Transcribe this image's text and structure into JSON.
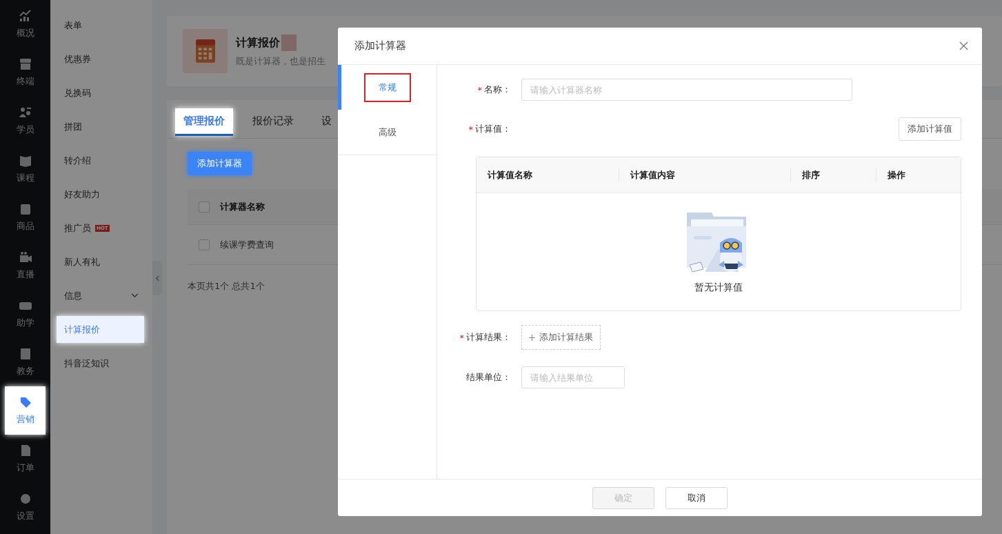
{
  "nav": [
    {
      "label": "概况",
      "selected": false
    },
    {
      "label": "终端",
      "selected": false
    },
    {
      "label": "学员",
      "selected": false
    },
    {
      "label": "课程",
      "selected": false
    },
    {
      "label": "商品",
      "selected": false
    },
    {
      "label": "直播",
      "selected": false
    },
    {
      "label": "助学",
      "selected": false
    },
    {
      "label": "教务",
      "selected": false
    },
    {
      "label": "营销",
      "selected": true
    },
    {
      "label": "订单",
      "selected": false
    },
    {
      "label": "设置",
      "selected": false
    }
  ],
  "submenu": [
    {
      "label": "表单",
      "selected": false
    },
    {
      "label": "优惠券",
      "selected": false
    },
    {
      "label": "兑换码",
      "selected": false
    },
    {
      "label": "拼团",
      "selected": false
    },
    {
      "label": "转介绍",
      "selected": false
    },
    {
      "label": "好友助力",
      "selected": false
    },
    {
      "label": "推广员",
      "selected": false,
      "badge": "HOT"
    },
    {
      "label": "新人有礼",
      "selected": false
    },
    {
      "label": "信息",
      "selected": false,
      "expandable": true
    },
    {
      "label": "计算报价",
      "selected": true
    },
    {
      "label": "抖音泛知识",
      "selected": false
    }
  ],
  "header_card": {
    "title": "计算报价",
    "subtitle": "既是计算器，也是招生"
  },
  "tabs": [
    {
      "label": "管理报价",
      "selected": true
    },
    {
      "label": "报价记录",
      "selected": false
    },
    {
      "label": "设",
      "selected": false
    }
  ],
  "add_button": {
    "label": "添加计算器",
    "spotlight": true
  },
  "table": {
    "header_checked": false,
    "columns": [
      "计算器名称"
    ],
    "rows": [
      {
        "name": "续课学费查询",
        "checked": false
      }
    ]
  },
  "pagination": "本页共1个 总共1个",
  "dialog": {
    "title": "添加计算器",
    "side_tabs": [
      {
        "label": "常规",
        "selected": true,
        "annotated": true
      },
      {
        "label": "高级",
        "selected": false,
        "annotated": false
      }
    ],
    "fields": [
      {
        "kind": "input",
        "label": "名称：",
        "required_mark": "*",
        "placeholder": "请输入计算器名称"
      },
      {
        "kind": "table",
        "label": "计算值：",
        "required_mark": "*",
        "action": "添加计算值",
        "columns": [
          "计算值名称",
          "计算值内容",
          "排序",
          "操作"
        ],
        "empty_text": "暂无计算值"
      },
      {
        "kind": "add",
        "label": "计算结果：",
        "required_mark": "*",
        "action": "添加计算结果"
      },
      {
        "kind": "short-input",
        "label": "结果单位：",
        "placeholder": "请输入结果单位"
      }
    ],
    "buttons": [
      {
        "label": "确定",
        "disabled": true
      },
      {
        "label": "取消",
        "disabled": false
      }
    ]
  }
}
